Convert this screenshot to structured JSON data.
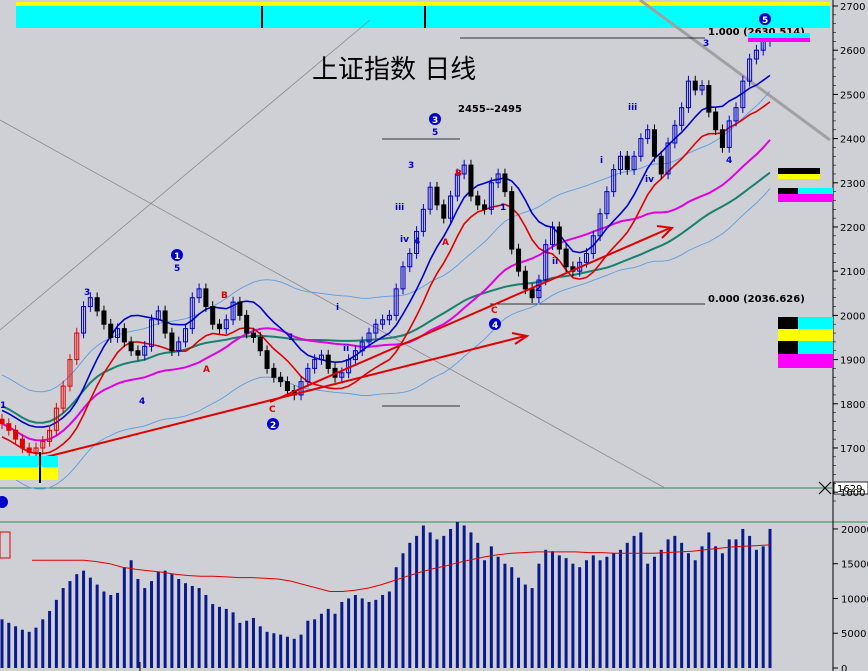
{
  "colors": {
    "background": "#cfcfd6",
    "up_candle": "#0000cc",
    "down_candle": "#000000",
    "red_candle": "#e00000",
    "ma_red": "#e00000",
    "ma_blue": "#0000cc",
    "ma_magenta": "#e000e0",
    "ma_teal": "#1a7f6f",
    "band_light": "#5a9ee0",
    "cyan": "#00ffff",
    "yellow": "#ffff00",
    "magenta": "#ff00ff",
    "volume": "#0a1a8c"
  },
  "labels": {
    "title": "上证指数  日线",
    "range_note": "2455--2495",
    "fib_top": "1.000 (2630.514)",
    "fib_bottom": "0.000 (2036.626)",
    "current_price": "1629."
  },
  "chart_data": [
    {
      "type": "candlestick",
      "title": "上证指数  日线",
      "ylim": [
        1580,
        2700
      ],
      "yticks": [
        "2700",
        "2600",
        "2500",
        "2400",
        "2300",
        "2200",
        "2100",
        "2000",
        "1900",
        "1800",
        "1700",
        "1600"
      ],
      "y_log": false,
      "grid": false,
      "close": [
        1755,
        1740,
        1720,
        1700,
        1690,
        1700,
        1715,
        1740,
        1790,
        1840,
        1900,
        1960,
        2020,
        2040,
        2010,
        1980,
        1950,
        1970,
        1940,
        1920,
        1910,
        1930,
        1990,
        2010,
        1960,
        1920,
        1940,
        1970,
        2040,
        2060,
        2020,
        1980,
        1970,
        1990,
        2030,
        2000,
        1960,
        1950,
        1920,
        1880,
        1860,
        1850,
        1830,
        1820,
        1850,
        1880,
        1900,
        1910,
        1880,
        1860,
        1870,
        1900,
        1920,
        1940,
        1960,
        1980,
        1990,
        2000,
        2060,
        2110,
        2140,
        2190,
        2240,
        2290,
        2250,
        2220,
        2270,
        2320,
        2340,
        2270,
        2250,
        2240,
        2300,
        2320,
        2280,
        2150,
        2100,
        2060,
        2040,
        2080,
        2160,
        2200,
        2150,
        2110,
        2100,
        2120,
        2140,
        2180,
        2230,
        2280,
        2330,
        2360,
        2330,
        2360,
        2400,
        2420,
        2360,
        2320,
        2390,
        2430,
        2470,
        2530,
        2510,
        2520,
        2460,
        2420,
        2380,
        2440,
        2470,
        2530,
        2580,
        2600,
        2620,
        2630
      ],
      "yellow_annotation_lines": [
        {
          "from_index": 2,
          "from_value": 1690,
          "to_index": 115,
          "to_value": 2630
        }
      ]
    },
    {
      "type": "bar",
      "title": "",
      "ylim": [
        0,
        21000
      ],
      "yticks": [
        "20000",
        "15000",
        "10000",
        "5000",
        "0"
      ],
      "values": [
        7000,
        6500,
        6000,
        5500,
        5200,
        5800,
        7000,
        8200,
        9800,
        11500,
        12500,
        13500,
        14000,
        13000,
        12000,
        11000,
        10500,
        10800,
        14500,
        15500,
        12800,
        11500,
        12500,
        13800,
        14000,
        13500,
        12800,
        12200,
        11800,
        11500,
        10500,
        9200,
        8800,
        8500,
        8000,
        6500,
        6800,
        7200,
        6000,
        5200,
        5000,
        4800,
        4500,
        4200,
        4800,
        6800,
        7000,
        7800,
        8500,
        7800,
        9500,
        10000,
        10500,
        10000,
        9500,
        9800,
        10500,
        11000,
        14500,
        16500,
        18000,
        19000,
        20500,
        19500,
        18500,
        19000,
        20000,
        21000,
        20500,
        19500,
        18000,
        15500,
        17500,
        16000,
        15000,
        14500,
        13000,
        12000,
        11500,
        15000,
        17000,
        16800,
        16200,
        15800,
        15000,
        14500,
        15500,
        16200,
        15500,
        16000,
        16500,
        17000,
        18000,
        19000,
        19500,
        15000,
        16000,
        17000,
        18500,
        19000,
        18000,
        16500,
        15500,
        17500,
        19500,
        17500,
        16500,
        18500,
        18500,
        20000,
        19000,
        17000,
        17500,
        20000
      ],
      "ma_values": [
        15500,
        15500,
        15500,
        15500,
        15500,
        15300,
        15000,
        14500,
        14200,
        14000,
        13800,
        13500,
        13300,
        13200,
        13200,
        13100,
        13000,
        13000,
        12900,
        12800,
        12500,
        12000,
        11500,
        11000,
        11000,
        11200,
        11500,
        12000,
        12600,
        13200,
        13800,
        14300,
        14700,
        15200,
        15600,
        16000,
        16300,
        16500,
        16600,
        16700,
        16700,
        16700,
        16700,
        16600,
        16600,
        16500,
        16500,
        16500,
        16500,
        16600,
        16700,
        16800,
        17000,
        17200,
        17400,
        17500,
        17600,
        17700
      ]
    }
  ]
}
